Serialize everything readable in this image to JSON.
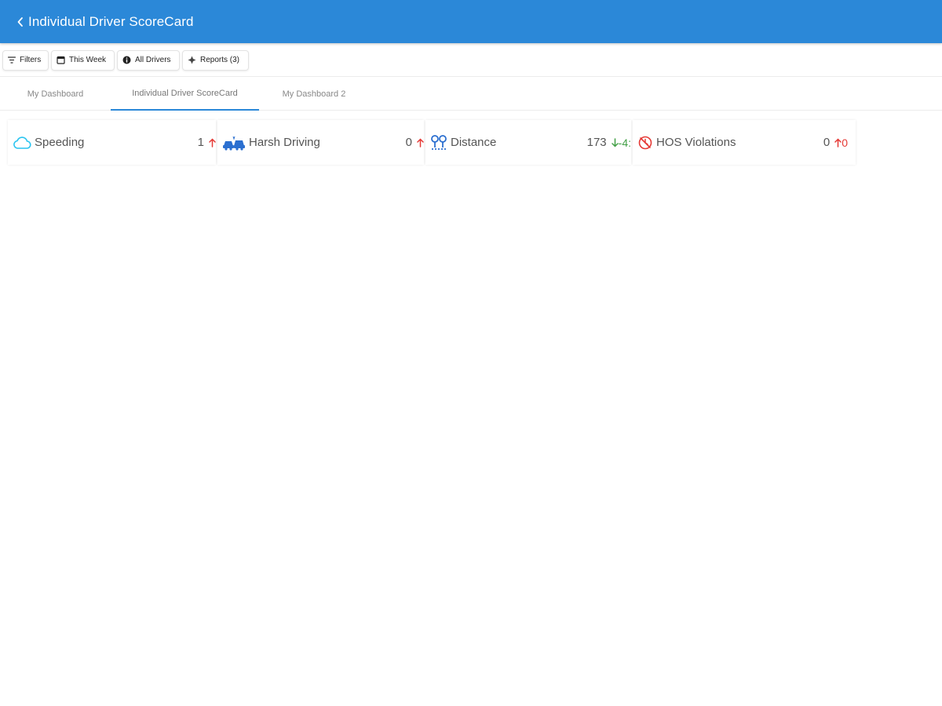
{
  "header": {
    "title": "Individual Driver ScoreCard",
    "background": "#2b88d8"
  },
  "toolbar": {
    "filters_label": "Filters",
    "date_label": "This Week",
    "drivers_label": "All Drivers",
    "reports_label": "Reports (3)"
  },
  "tabs": [
    {
      "label": "My Dashboard",
      "active": false
    },
    {
      "label": "Individual Driver ScoreCard",
      "active": true
    },
    {
      "label": "My Dashboard 2",
      "active": false
    }
  ],
  "cards": [
    {
      "label": "Speeding",
      "value": "1",
      "trend_dir": "up",
      "trend_value": "",
      "trend_color": "#e53935",
      "icon": "cloud-icon"
    },
    {
      "label": "Harsh Driving",
      "value": "0",
      "trend_dir": "up",
      "trend_value": "",
      "trend_color": "#e53935",
      "icon": "car-crash-icon"
    },
    {
      "label": "Distance",
      "value": "173",
      "trend_dir": "down",
      "trend_value": "-4:",
      "trend_color": "#43a047",
      "icon": "map-pins-icon"
    },
    {
      "label": "HOS Violations",
      "value": "0",
      "trend_dir": "up",
      "trend_value": "0",
      "trend_color": "#e53935",
      "icon": "no-clock-icon"
    }
  ]
}
